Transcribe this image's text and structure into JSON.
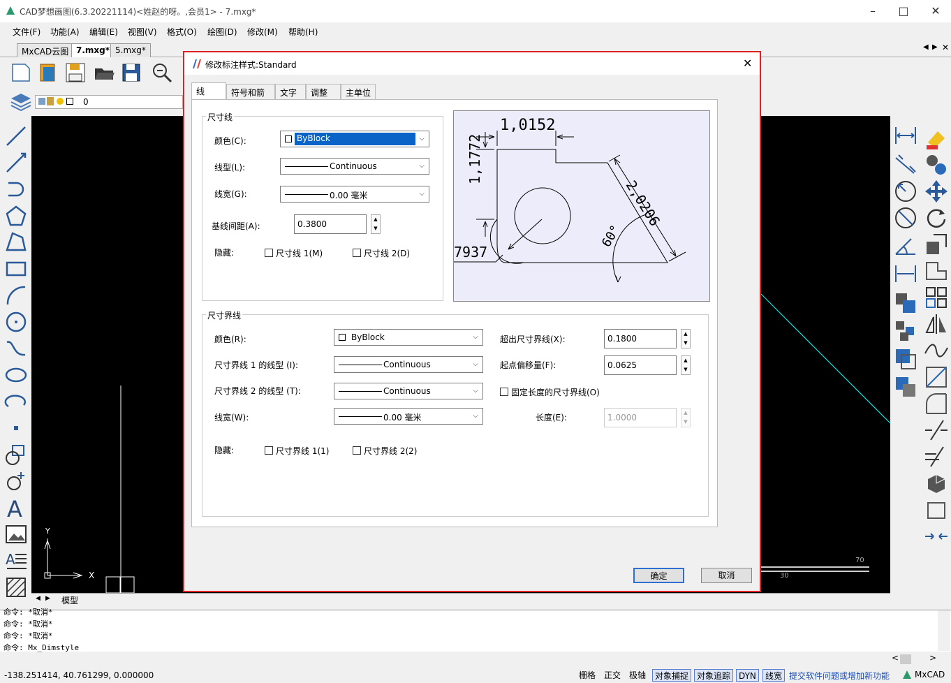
{
  "window": {
    "title": "CAD梦想画图(6.3.20221114)<姓赵的呀。,会员1> - 7.mxg*"
  },
  "menu": [
    "文件(F)",
    "功能(A)",
    "编辑(E)",
    "视图(V)",
    "格式(O)",
    "绘图(D)",
    "修改(M)",
    "帮助(H)"
  ],
  "doc_tabs": [
    "MxCAD云图",
    "7.mxg*",
    "5.mxg*"
  ],
  "layer": {
    "name": "0"
  },
  "model_tab": "模型",
  "command_lines": [
    "命令:  *取消*",
    "命令:  *取消*",
    "命令:  *取消*",
    "命令: Mx_Dimstyle"
  ],
  "status": {
    "coords": "-138.251414,  40.761299,  0.000000",
    "buttons": [
      "栅格",
      "正交",
      "极轴",
      "对象捕捉",
      "对象追踪",
      "DYN",
      "线宽"
    ],
    "feedback": "提交软件问题或增加新功能",
    "brand": "MxCAD"
  },
  "canvas": {
    "ucs_x": "X",
    "ucs_y": "Y",
    "tick_70": "70",
    "tick_30": "30"
  },
  "dialog": {
    "title": "修改标注样式:Standard",
    "tabs": [
      "线",
      "符号和箭头",
      "文字",
      "调整",
      "主单位"
    ],
    "dim_group": "尺寸线",
    "color_label": "颜色(C):",
    "color_value": "ByBlock",
    "linetype_label": "线型(L):",
    "linetype_value": "Continuous",
    "lineweight_label": "线宽(G):",
    "lineweight_value": "0.00 毫米",
    "baseline_label": "基线间距(A):",
    "baseline_value": "0.3800",
    "hide_label": "隐藏:",
    "hide_dim1": "尺寸线 1(M)",
    "hide_dim2": "尺寸线 2(D)",
    "ext_group": "尺寸界线",
    "ext_color_label": "颜色(R):",
    "ext_color_value": "ByBlock",
    "ext_lt1_label": "尺寸界线 1 的线型 (I):",
    "ext_lt1_value": "Continuous",
    "ext_lt2_label": "尺寸界线 2 的线型 (T):",
    "ext_lt2_value": "Continuous",
    "ext_lw_label": "线宽(W):",
    "ext_lw_value": "0.00 毫米",
    "extend_label": "超出尺寸界线(X):",
    "extend_value": "0.1800",
    "offset_label": "起点偏移量(F):",
    "offset_value": "0.0625",
    "fixed_label": "固定长度的尺寸界线(O)",
    "length_label": "长度(E):",
    "length_value": "1.0000",
    "ext_hide_label": "隐藏:",
    "ext_hide1": "尺寸界线 1(1)",
    "ext_hide2": "尺寸界线 2(2)",
    "preview": {
      "d1": "1,0152",
      "d2": "1,1772",
      "d3": "2,0206",
      "d4": "60°",
      "d5": "7937"
    },
    "ok": "确定",
    "cancel": "取消"
  }
}
